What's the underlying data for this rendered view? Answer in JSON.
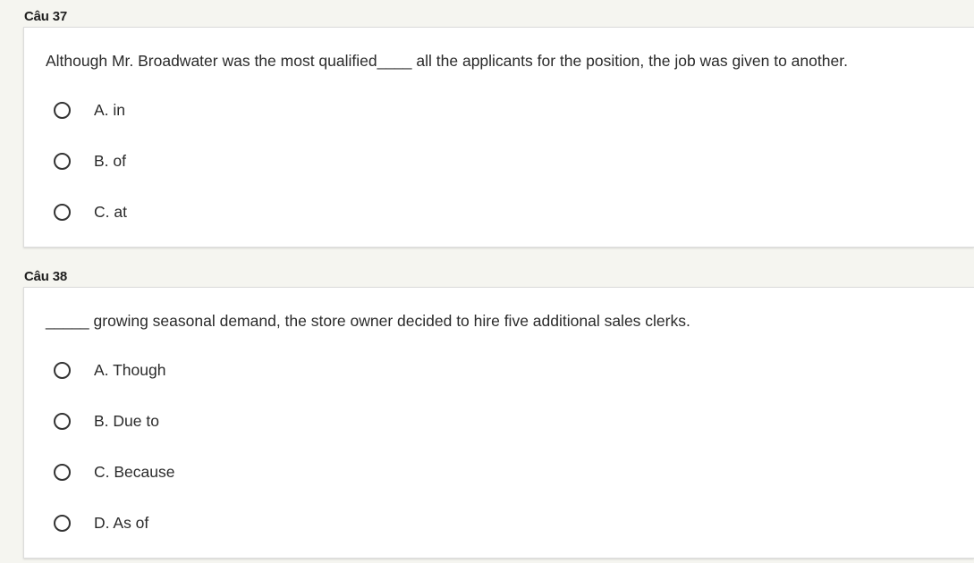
{
  "questions": [
    {
      "label": "Câu 37",
      "text": "Although Mr. Broadwater was the most qualified____ all the applicants for the position, the job was given to another.",
      "options": [
        "A. in",
        "B. of",
        "C. at"
      ]
    },
    {
      "label": "Câu 38",
      "text": "_____ growing seasonal demand, the store owner decided to hire five additional sales clerks.",
      "options": [
        "A. Though",
        "B. Due to",
        "C. Because",
        "D. As of"
      ]
    }
  ]
}
